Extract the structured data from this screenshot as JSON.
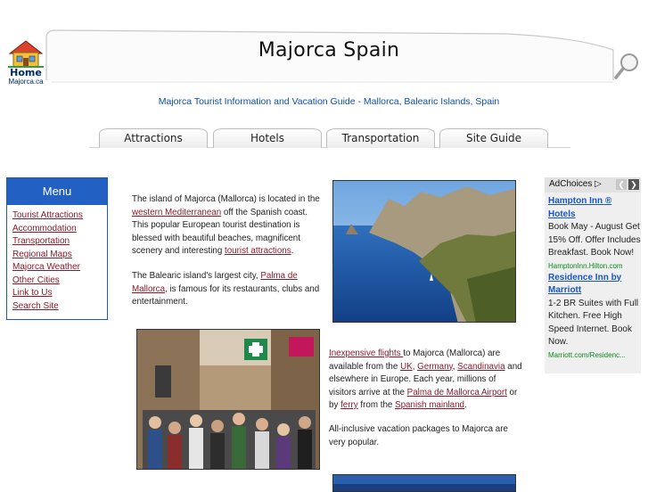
{
  "header": {
    "home_word": "Home",
    "home_site": "Majorca.ca",
    "title": "Majorca Spain",
    "tagline": "Majorca Tourist Information and Vacation Guide - Mallorca, Balearic Islands, Spain"
  },
  "tabs": [
    {
      "label": "Attractions"
    },
    {
      "label": "Hotels"
    },
    {
      "label": "Transportation"
    },
    {
      "label": "Site Guide"
    }
  ],
  "menu": {
    "title": "Menu",
    "items": [
      {
        "label": "Tourist Attractions"
      },
      {
        "label": "Accommodation"
      },
      {
        "label": "Transportation"
      },
      {
        "label": "Regional Maps"
      },
      {
        "label": "Majorca Weather"
      },
      {
        "label": "Other Cities"
      },
      {
        "label": "Link to Us"
      },
      {
        "label": "Search Site"
      }
    ]
  },
  "content": {
    "p1": {
      "t1": "The island of Majorca (Mallorca) is located in the",
      "l1": "western Mediterranean",
      "t2": " off the Spanish coast. This popular European tourist destination is blessed with beautiful beaches, magnificent scenery and interesting ",
      "l2": "tourist attractions",
      "t3": "."
    },
    "p2": {
      "t1": "The Balearic island's largest city, ",
      "l1": "Palma de Mallorca",
      "t2": ", is famous for its restaurants, clubs and entertainment."
    },
    "p3": {
      "l1": "Inexpensive flights ",
      "t1": "to Majorca (Mallorca) are available from the ",
      "l2": "UK",
      "t2": ", ",
      "l3": "Germany",
      "t3": ", ",
      "l4": "Scandinavia",
      "t4": " and elsewhere in Europe.  Each year, millions of visitors arrive at the ",
      "l5": "Palma de Mallorca Airport",
      "t5": " or by ",
      "l6": "ferry",
      "t6": " from the ",
      "l7": "Spanish mainland",
      "t7": "."
    },
    "p4": "All-inclusive vacation packages to Majorca are very popular."
  },
  "ad": {
    "choices_label": "AdChoices",
    "items": [
      {
        "title": "Hampton Inn ® Hotels",
        "text": "Book May - August Get 15% Off. Offer Includes Breakfast. Book Now!",
        "url": "HamptonInn.Hilton.com"
      },
      {
        "title": "Residence Inn by Marriott",
        "text": "1-2 BR Suites with Full Kitchen. Free High Speed Internet. Book Now.",
        "url": "Marriott.com/Residenc..."
      }
    ]
  },
  "colors": {
    "menu_header": "#2260c4",
    "link": "#8b1a2b",
    "tagline": "#0b4fb0",
    "ad_title": "#1a55c8",
    "ad_url": "#0a8a1a"
  }
}
